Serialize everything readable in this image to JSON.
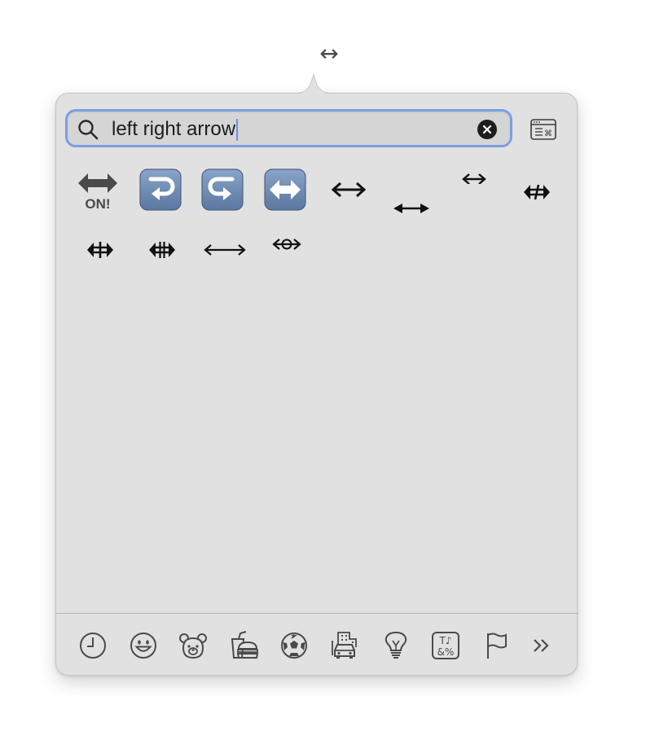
{
  "cursor": {
    "glyph": "↔"
  },
  "search": {
    "value": "left right arrow",
    "icon": "search-icon"
  },
  "toolbar": {
    "clear_icon": "clear-icon",
    "viewer_icon": "character-viewer-icon"
  },
  "results": [
    {
      "id": "on-arrow",
      "label": "ON!",
      "type": "emoji"
    },
    {
      "id": "right-arrow-curving-left",
      "type": "emoji"
    },
    {
      "id": "left-arrow-curving-right",
      "type": "emoji"
    },
    {
      "id": "left-right-arrow-emoji",
      "type": "emoji"
    },
    {
      "id": "left-right-arrow",
      "type": "symbol"
    },
    {
      "id": "left-right-arrow-heavy",
      "type": "symbol"
    },
    {
      "id": "left-right-arrow-small",
      "type": "symbol"
    },
    {
      "id": "left-right-double-arrow-stroke",
      "type": "symbol"
    },
    {
      "id": "left-right-double-arrow-stroke-2",
      "type": "symbol"
    },
    {
      "id": "left-right-double-arrow-stroke-3",
      "type": "symbol"
    },
    {
      "id": "long-left-right-arrow",
      "type": "symbol"
    },
    {
      "id": "left-right-arrow-circle",
      "type": "symbol"
    }
  ],
  "categories": [
    {
      "name": "frequently-used",
      "icon": "clock-icon"
    },
    {
      "name": "smileys-people",
      "icon": "smiley-icon"
    },
    {
      "name": "animals-nature",
      "icon": "bear-icon"
    },
    {
      "name": "food-drink",
      "icon": "food-icon"
    },
    {
      "name": "activity",
      "icon": "soccer-ball-icon"
    },
    {
      "name": "travel-places",
      "icon": "car-building-icon"
    },
    {
      "name": "objects",
      "icon": "lightbulb-icon"
    },
    {
      "name": "symbols",
      "icon": "symbols-icon",
      "label_top": "T♪",
      "label_bottom": "&%"
    },
    {
      "name": "flags",
      "icon": "flag-icon"
    },
    {
      "name": "more",
      "icon": "chevron-double-right-icon"
    }
  ],
  "colors": {
    "panel": "#e1e1e1",
    "focus_ring": "#7b9fe3",
    "emoji_blue": "#6d89b0",
    "glyph": "#111111"
  }
}
